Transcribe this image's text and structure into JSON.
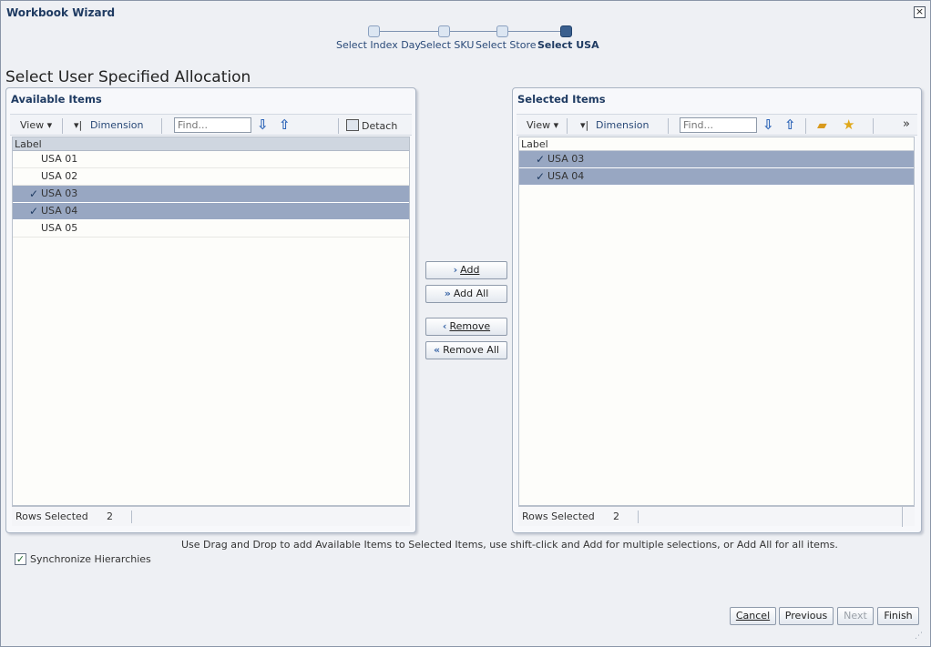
{
  "window": {
    "title": "Workbook Wizard",
    "close_glyph": "×"
  },
  "train": {
    "steps": [
      {
        "label": "Select Index Day",
        "state": "visited"
      },
      {
        "label": "Select SKU",
        "state": "visited"
      },
      {
        "label": "Select Store",
        "state": "visited"
      },
      {
        "label": "Select USA",
        "state": "current"
      }
    ]
  },
  "page": {
    "title": "Select User Specified Allocation"
  },
  "available": {
    "title": "Available Items",
    "toolbar": {
      "view_label": "View",
      "dimension_label": "Dimension",
      "find_placeholder": "Find...",
      "detach_label": "Detach"
    },
    "column_header": "Label",
    "rows": [
      {
        "label": "USA 01",
        "selected": false
      },
      {
        "label": "USA 02",
        "selected": false
      },
      {
        "label": "USA 03",
        "selected": true
      },
      {
        "label": "USA 04",
        "selected": true
      },
      {
        "label": "USA 05",
        "selected": false
      }
    ],
    "status": {
      "label": "Rows Selected",
      "count": "2"
    }
  },
  "selected": {
    "title": "Selected Items",
    "toolbar": {
      "view_label": "View",
      "dimension_label": "Dimension",
      "find_placeholder": "Find...",
      "overflow_glyph": "»"
    },
    "column_header": "Label",
    "rows": [
      {
        "label": "USA 03",
        "selected": true
      },
      {
        "label": "USA 04",
        "selected": true
      }
    ],
    "status": {
      "label": "Rows Selected",
      "count": "2"
    }
  },
  "shuttle": {
    "add": "Add",
    "add_all": "Add All",
    "remove": "Remove",
    "remove_all": "Remove All"
  },
  "instructions": "Use Drag and Drop to add Available Items to Selected Items, use shift-click and Add for multiple selections, or Add All for all items.",
  "sync": {
    "label": "Synchronize Hierarchies",
    "checked": true
  },
  "footer": {
    "cancel": "Cancel",
    "previous": "Previous",
    "next": "Next",
    "finish": "Finish"
  },
  "colors": {
    "selected_row": "#98a7c2",
    "title_blue": "#1f3b62",
    "current_step": "#3a5f8e"
  }
}
